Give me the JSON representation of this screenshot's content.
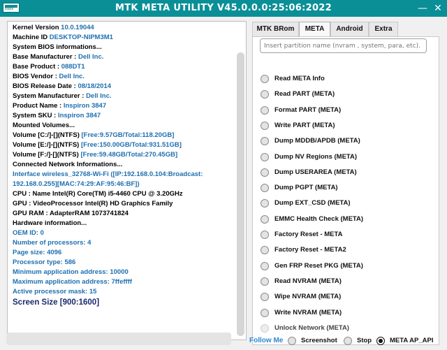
{
  "titlebar": {
    "title": "MTK META UTILITY V45.0.0.0:25:06:2022",
    "icon": "app-logo-icon",
    "icon_caption": "tools",
    "minimize": "—",
    "close": "✕"
  },
  "log": {
    "lines": [
      {
        "text": "Kernel Version ",
        "value": "10.0.19044"
      },
      {
        "text": "Machine ID ",
        "value": "DESKTOP-NIPM3M1"
      },
      {
        "text": "System BIOS informations...",
        "value": ""
      },
      {
        "text": "Base Manufacturer : ",
        "value": "Dell Inc."
      },
      {
        "text": "Base Product : ",
        "value": "088DT1"
      },
      {
        "text": "BIOS Vendor : ",
        "value": "Dell Inc."
      },
      {
        "text": "BIOS Release Date : ",
        "value": "08/18/2014"
      },
      {
        "text": "System Manufacturer : ",
        "value": "Dell Inc."
      },
      {
        "text": "Product Name : ",
        "value": "Inspiron 3847"
      },
      {
        "text": "System SKU : ",
        "value": "Inspiron 3847"
      },
      {
        "text": "Mounted Volumes...",
        "value": ""
      },
      {
        "text": "Volume [C:/]-[](NTFS) ",
        "value": "[Free:9.57GB/Total:118.20GB]"
      },
      {
        "text": "Volume [E:/]-[](NTFS) ",
        "value": "[Free:150.00GB/Total:931.51GB]"
      },
      {
        "text": "Volume [F:/]-[](NTFS) ",
        "value": "[Free:59.48GB/Total:270.45GB]"
      },
      {
        "text": "Connected Network Informations...",
        "value": ""
      },
      {
        "text": "",
        "value": "Interface wireless_32768-Wi-Fi ([IP:192.168.0.104:Broadcast:"
      },
      {
        "text": "",
        "value": "192.168.0.255][MAC:74:29:AF:95:46:BF])"
      },
      {
        "text": "CPU   : Name Intel(R) Core(TM) i5-4460 CPU @ 3.20GHz",
        "value": ""
      },
      {
        "text": "GPU   : VideoProcessor Intel(R) HD Graphics Family",
        "value": ""
      },
      {
        "text": "GPU RAM   : AdapterRAM 1073741824",
        "value": ""
      },
      {
        "text": "Hardware information...",
        "value": ""
      },
      {
        "text": "",
        "value": "OEM ID: 0"
      },
      {
        "text": "",
        "value": "Number of processors: 4"
      },
      {
        "text": "",
        "value": "Page size: 4096"
      },
      {
        "text": "",
        "value": "Processor type: 586"
      },
      {
        "text": "",
        "value": "Minimum application address: 10000"
      },
      {
        "text": "",
        "value": "Maximum application address: 7ffeffff"
      },
      {
        "text": "",
        "value": "Active processor mask: 15"
      }
    ],
    "screen_size": "Screen Size [900:1600]"
  },
  "tabs": [
    "MTK BRom",
    "META",
    "Android",
    "Extra"
  ],
  "active_tab": "META",
  "search": {
    "placeholder": "Insert partition name (nvram , system, para, etc)."
  },
  "options": [
    "Read META Info",
    "Read PART (META)",
    "Format PART (META)",
    "Write PART (META)",
    "Dump MDDB/APDB (META)",
    "Dump NV Regions (META)",
    "Dump USERAREA (META)",
    "Dump PGPT (META)",
    "Dump  EXT_CSD (META)",
    "EMMC Health Check (META)",
    "Factory Reset - META",
    "Factory Reset - META2",
    "Gen FRP Reset PKG (META)",
    "Read NVRAM (META)",
    "Wipe NVRAM (META)",
    "Write NVRAM (META)",
    "Unlock Network (META)"
  ],
  "footer": {
    "follow": "Follow Me",
    "screenshot": "Screenshot",
    "stop": "Stop",
    "meta_api": "META AP_API",
    "selected": "META AP_API"
  },
  "colors": {
    "titlebar": "#0a8f97",
    "value_text": "#1e6fb0",
    "link": "#2e86d6"
  }
}
